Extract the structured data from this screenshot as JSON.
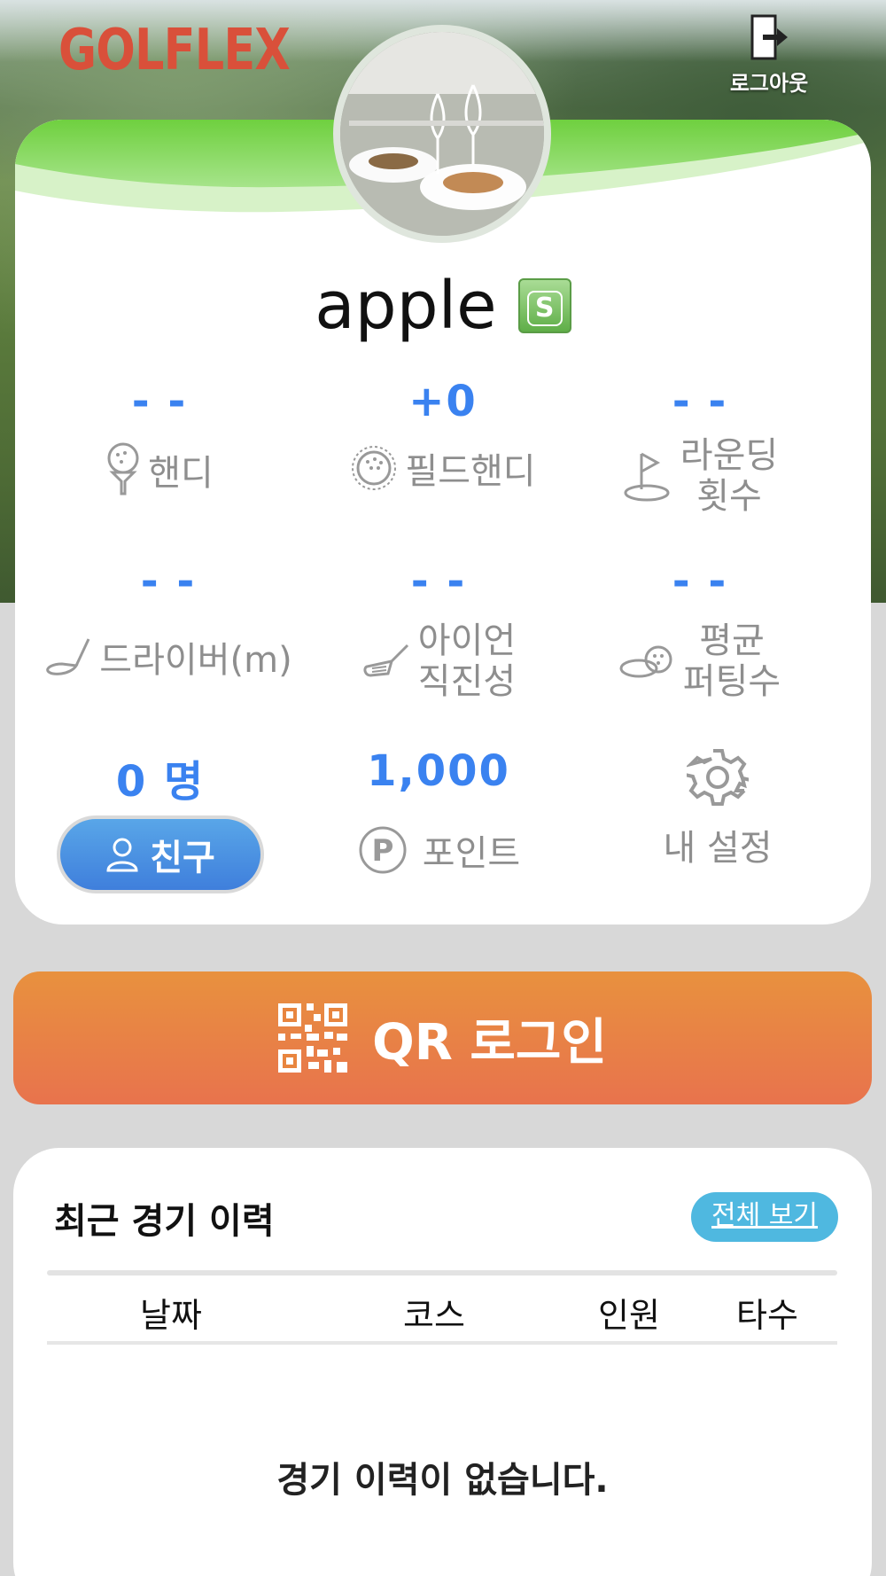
{
  "header": {
    "logo": "GOLFLEX",
    "logout_label": "로그아웃"
  },
  "profile": {
    "username": "apple",
    "grade": "S"
  },
  "stats": {
    "handicap": {
      "value": "- -",
      "label": "핸디"
    },
    "field_handicap": {
      "value": "+0",
      "label": "필드핸디"
    },
    "rounds": {
      "value": "- -",
      "label_line1": "라운딩",
      "label_line2": "횟수"
    },
    "driver": {
      "value": "- -",
      "label": "드라이버(m)"
    },
    "iron": {
      "value": "- -",
      "label_line1": "아이언",
      "label_line2": "직진성"
    },
    "putting": {
      "value": "- -",
      "label_line1": "평균",
      "label_line2": "퍼팅수"
    },
    "friends": {
      "value": "0 명",
      "button_label": "친구"
    },
    "points": {
      "value": "1,000",
      "label": "포인트"
    },
    "settings": {
      "label": "내 설정"
    }
  },
  "qr": {
    "label": "QR 로그인"
  },
  "history": {
    "title": "최근 경기 이력",
    "view_all": "전체 보기",
    "columns": [
      "날짜",
      "코스",
      "인원",
      "타수"
    ],
    "empty_message": "경기 이력이 없습니다."
  },
  "colors": {
    "accent_blue": "#3a82f0",
    "logo_red": "#d9503a",
    "qr_orange": "#e8853f",
    "header_green": "#7ed24a"
  }
}
